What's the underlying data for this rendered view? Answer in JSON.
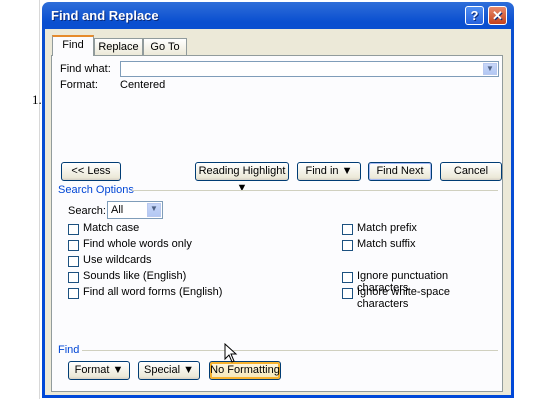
{
  "document": {
    "list_marker": "1."
  },
  "dialog": {
    "title": "Find and Replace",
    "help_glyph": "?",
    "close_glyph": "✕",
    "tabs": [
      {
        "label": "Find",
        "active": true
      },
      {
        "label": "Replace",
        "active": false
      },
      {
        "label": "Go To",
        "active": false
      }
    ],
    "find_what": {
      "label": "Find what:",
      "value": ""
    },
    "format": {
      "label": "Format:",
      "value": "Centered"
    },
    "buttons": {
      "less": "<< Less",
      "reading_highlight": "Reading Highlight",
      "find_in": "Find in",
      "find_next": "Find Next",
      "cancel": "Cancel"
    },
    "search_options": {
      "heading": "Search Options",
      "search_label": "Search:",
      "search_value": "All",
      "left_options": [
        {
          "label": "Match case",
          "checked": false
        },
        {
          "label": "Find whole words only",
          "checked": false
        },
        {
          "label": "Use wildcards",
          "checked": false
        },
        {
          "label": "Sounds like (English)",
          "checked": false
        },
        {
          "label": "Find all word forms (English)",
          "checked": false
        }
      ],
      "right_options": [
        {
          "label": "Match prefix",
          "checked": false
        },
        {
          "label": "Match suffix",
          "checked": false
        },
        {
          "label": "Ignore punctuation characters",
          "checked": false
        },
        {
          "label": "Ignore white-space characters",
          "checked": false
        }
      ]
    },
    "find_section": {
      "heading": "Find",
      "format_button": "Format",
      "special_button": "Special",
      "no_formatting_button": "No Formatting"
    },
    "colors": {
      "titlebar": "#0a4fd0",
      "client": "#ece9d8",
      "section_heading": "#0046d5",
      "active_tab_accent": "#e68b2c"
    }
  }
}
